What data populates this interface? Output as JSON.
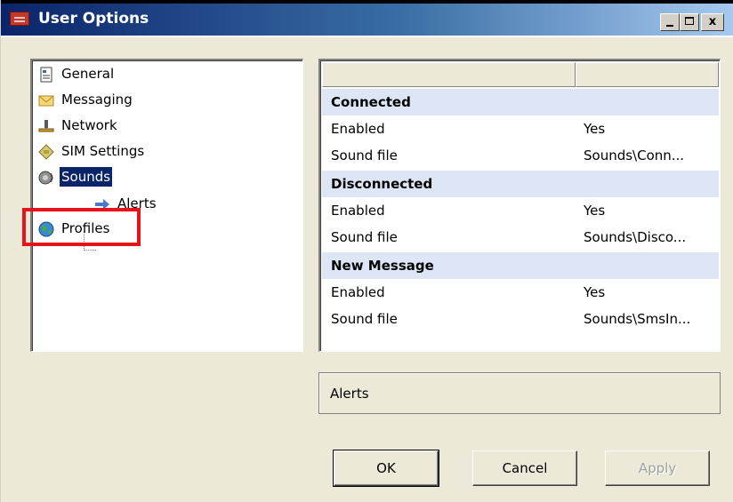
{
  "window": {
    "title": "User Options",
    "minimize_label": "_",
    "maximize_label": "□",
    "close_label": "x"
  },
  "tree": {
    "items": [
      {
        "label": "General",
        "icon": "document-icon"
      },
      {
        "label": "Messaging",
        "icon": "envelope-icon"
      },
      {
        "label": "Network",
        "icon": "network-icon"
      },
      {
        "label": "SIM Settings",
        "icon": "sim-card-icon"
      },
      {
        "label": "Sounds",
        "icon": "speaker-icon",
        "selected": true
      },
      {
        "label": "Alerts",
        "icon": "arrow-icon"
      },
      {
        "label": "Profiles",
        "icon": "globe-icon"
      }
    ]
  },
  "grid": {
    "rows": [
      {
        "type": "category",
        "label": "Connected"
      },
      {
        "type": "row",
        "label": "Enabled",
        "value": "Yes"
      },
      {
        "type": "row",
        "label": "Sound file",
        "value": "Sounds\\Conn..."
      },
      {
        "type": "category",
        "label": "Disconnected"
      },
      {
        "type": "row",
        "label": "Enabled",
        "value": "Yes"
      },
      {
        "type": "row",
        "label": "Sound file",
        "value": "Sounds\\Disco..."
      },
      {
        "type": "category",
        "label": "New Message"
      },
      {
        "type": "row",
        "label": "Enabled",
        "value": "Yes"
      },
      {
        "type": "row",
        "label": "Sound file",
        "value": "Sounds\\SmsIn..."
      }
    ]
  },
  "status": {
    "text": "Alerts"
  },
  "buttons": {
    "ok": "OK",
    "cancel": "Cancel",
    "apply": "Apply"
  },
  "colors": {
    "selection": "#0a246a",
    "highlight": "#e8131a",
    "category_bg": "#dde6f5"
  }
}
